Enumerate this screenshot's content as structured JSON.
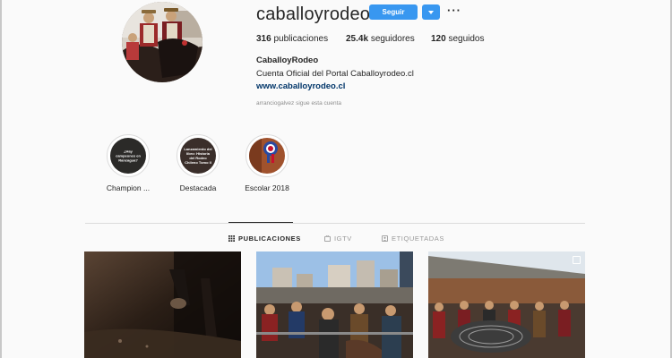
{
  "profile": {
    "username": "caballoyrodeo.cl",
    "follow_label": "Seguir",
    "more_label": "···",
    "stats": {
      "posts_count": "316",
      "posts_label": "publicaciones",
      "followers_count": "25.4k",
      "followers_label": "seguidores",
      "following_count": "120",
      "following_label": "seguidos"
    },
    "full_name": "CaballoyRodeo",
    "bio": "Cuenta Oficial del Portal Caballoyrodeo.cl",
    "website": "www.caballoyrodeo.cl",
    "followed_by": "arranciogalvez",
    "followed_by_suffix": "sigue esta cuenta"
  },
  "highlights": [
    {
      "label": "Champion ...",
      "cover_text": "¿Hay campeones en Rancagua?"
    },
    {
      "label": "Destacada",
      "cover_text": "Lanzamiento del libro: Historia del Rodeo Chileno Tomo II"
    },
    {
      "label": "Escolar 2018",
      "cover_text": ""
    }
  ],
  "tabs": [
    {
      "label": "PUBLICACIONES",
      "icon": "grid-icon",
      "active": true
    },
    {
      "label": "IGTV",
      "icon": "tv-icon",
      "active": false
    },
    {
      "label": "ETIQUETADAS",
      "icon": "tag-icon",
      "active": false
    }
  ],
  "colors": {
    "accent": "#3897f0",
    "link": "#003569",
    "muted": "#8e8e8e",
    "border": "#dbdbdb"
  }
}
